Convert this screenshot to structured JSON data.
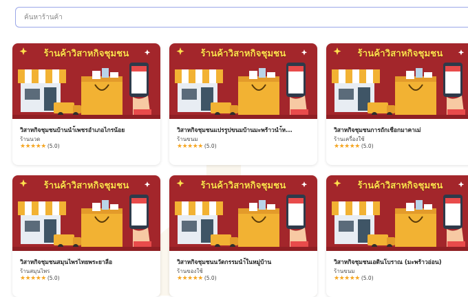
{
  "search": {
    "placeholder": "ค้นหาร้านค้า"
  },
  "colors": {
    "banner_bg": "#a3262b",
    "banner_title": "#ffe14d",
    "star": "#f5a623",
    "search_border": "#9aa6e8"
  },
  "shops": [
    {
      "banner_title": "ร้านค้าวิสาหกิจชุมชน",
      "name": "วิสาหกิจชุมชนบ้านนำ้เพชรอำเภอไกรน้อย",
      "category": "ร้านนวด",
      "stars": "★★★★★",
      "score": "(5.0)"
    },
    {
      "banner_title": "ร้านค้าวิสาหกิจชุมชน",
      "name": "วิสาหกิจชุมชนแปรรูปขนมบ้านมะพร้าวนำ้ห...",
      "category": "ร้านขนม",
      "stars": "★★★★★",
      "score": "(5.0)"
    },
    {
      "banner_title": "ร้านค้าวิสาหกิจชุมชน",
      "name": "วิสาหกิจชุมชนการถักเชือกมาคาเม่",
      "category": "ร้านเครื่องใช้",
      "stars": "★★★★★",
      "score": "(5.0)"
    },
    {
      "banner_title": "ร้านค้าวิสาหกิจชุมชน",
      "name": "วิสาหกิจชุมชนสมุนไพรไทยพระยาลือ",
      "category": "ร้านสมุนไพร",
      "stars": "★★★★★",
      "score": "(5.0)"
    },
    {
      "banner_title": "ร้านค้าวิสาหกิจชุมชน",
      "name": "วิสาหกิจชุมชนนวัตกรรมนำ้ในหมู่บ้าน",
      "category": "ร้านของใช้",
      "stars": "★★★★★",
      "score": "(5.0)"
    },
    {
      "banner_title": "ร้านค้าวิสาหกิจชุมชน",
      "name": "วิสาหกิจชุมชนเอดินโบราณ (มะพร้าวอ่อน)",
      "category": "ร้านขนม",
      "stars": "★★★★★",
      "score": "(5.0)"
    }
  ]
}
